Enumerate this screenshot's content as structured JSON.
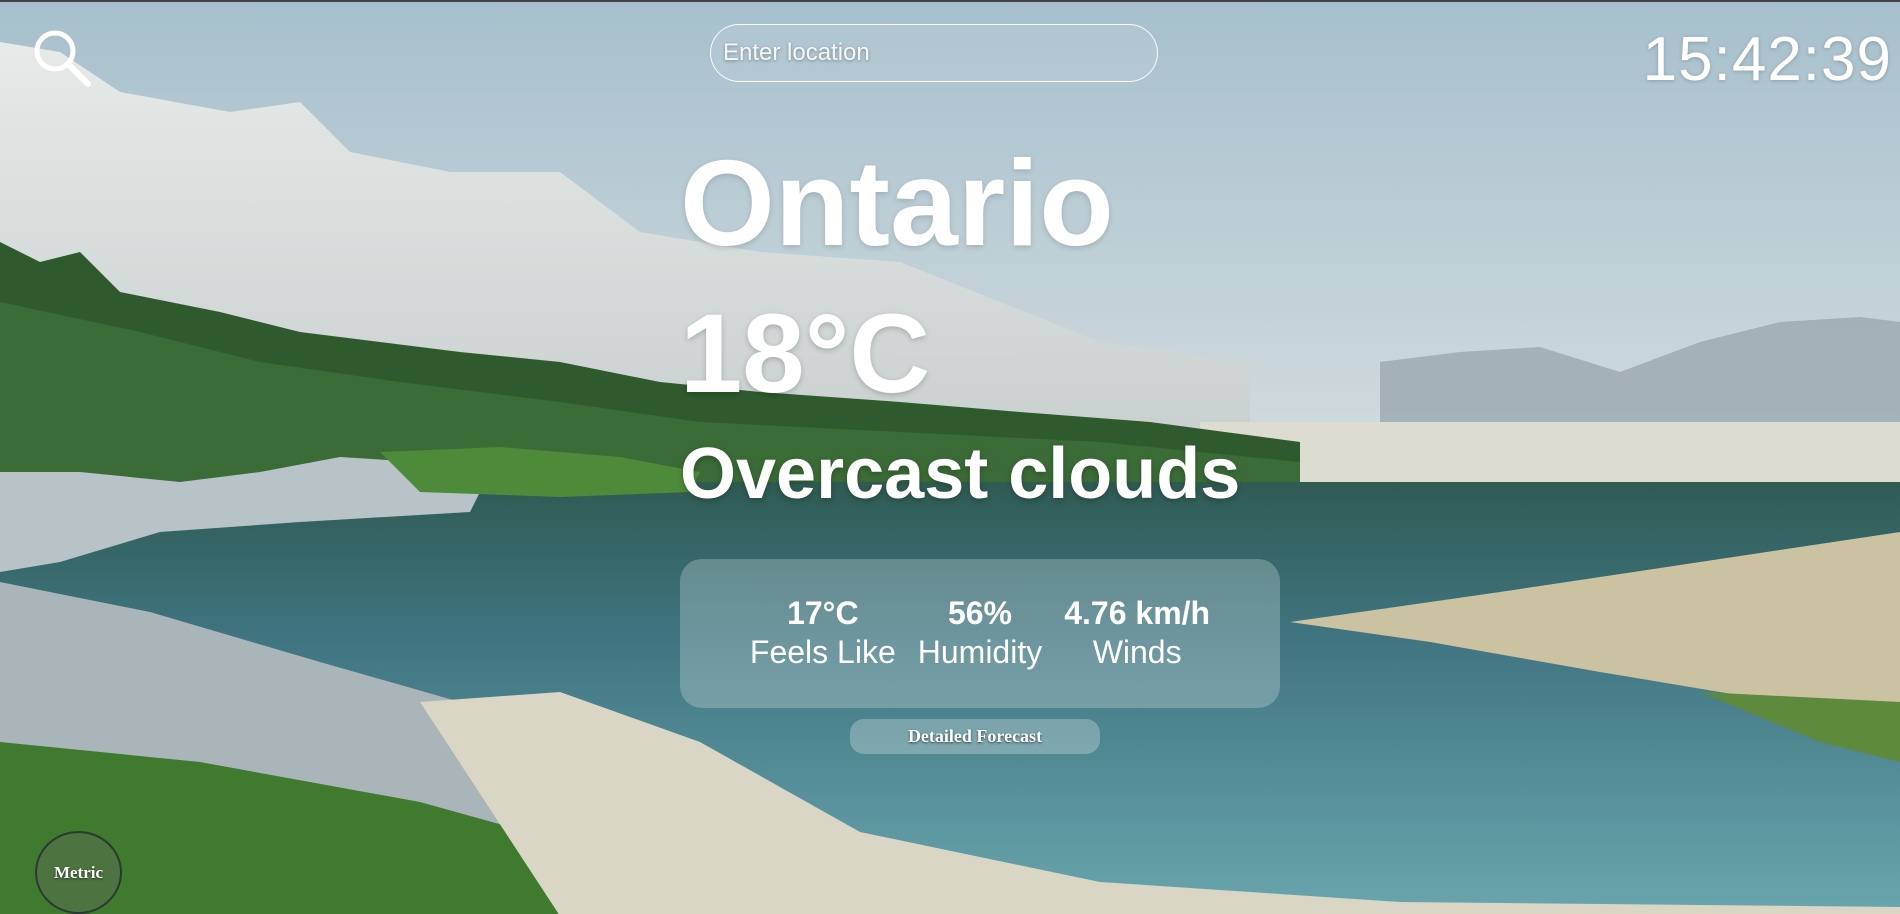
{
  "search": {
    "icon": "search-icon",
    "placeholder": "Enter location"
  },
  "clock": "15:42:39",
  "weather": {
    "city": "Ontario",
    "temperature": "18°C",
    "condition": "Overcast clouds"
  },
  "stats": [
    {
      "value": "17°C",
      "label": "Feels Like"
    },
    {
      "value": "56%",
      "label": "Humidity"
    },
    {
      "value": "4.76 km/h",
      "label": "Winds"
    }
  ],
  "forecast_button": "Detailed Forecast",
  "unit_button": "Metric",
  "colors": {
    "text": "#ffffff",
    "sky": "#b8ccd6",
    "water": "#4f8a93",
    "forest": "#2f5a2e"
  }
}
